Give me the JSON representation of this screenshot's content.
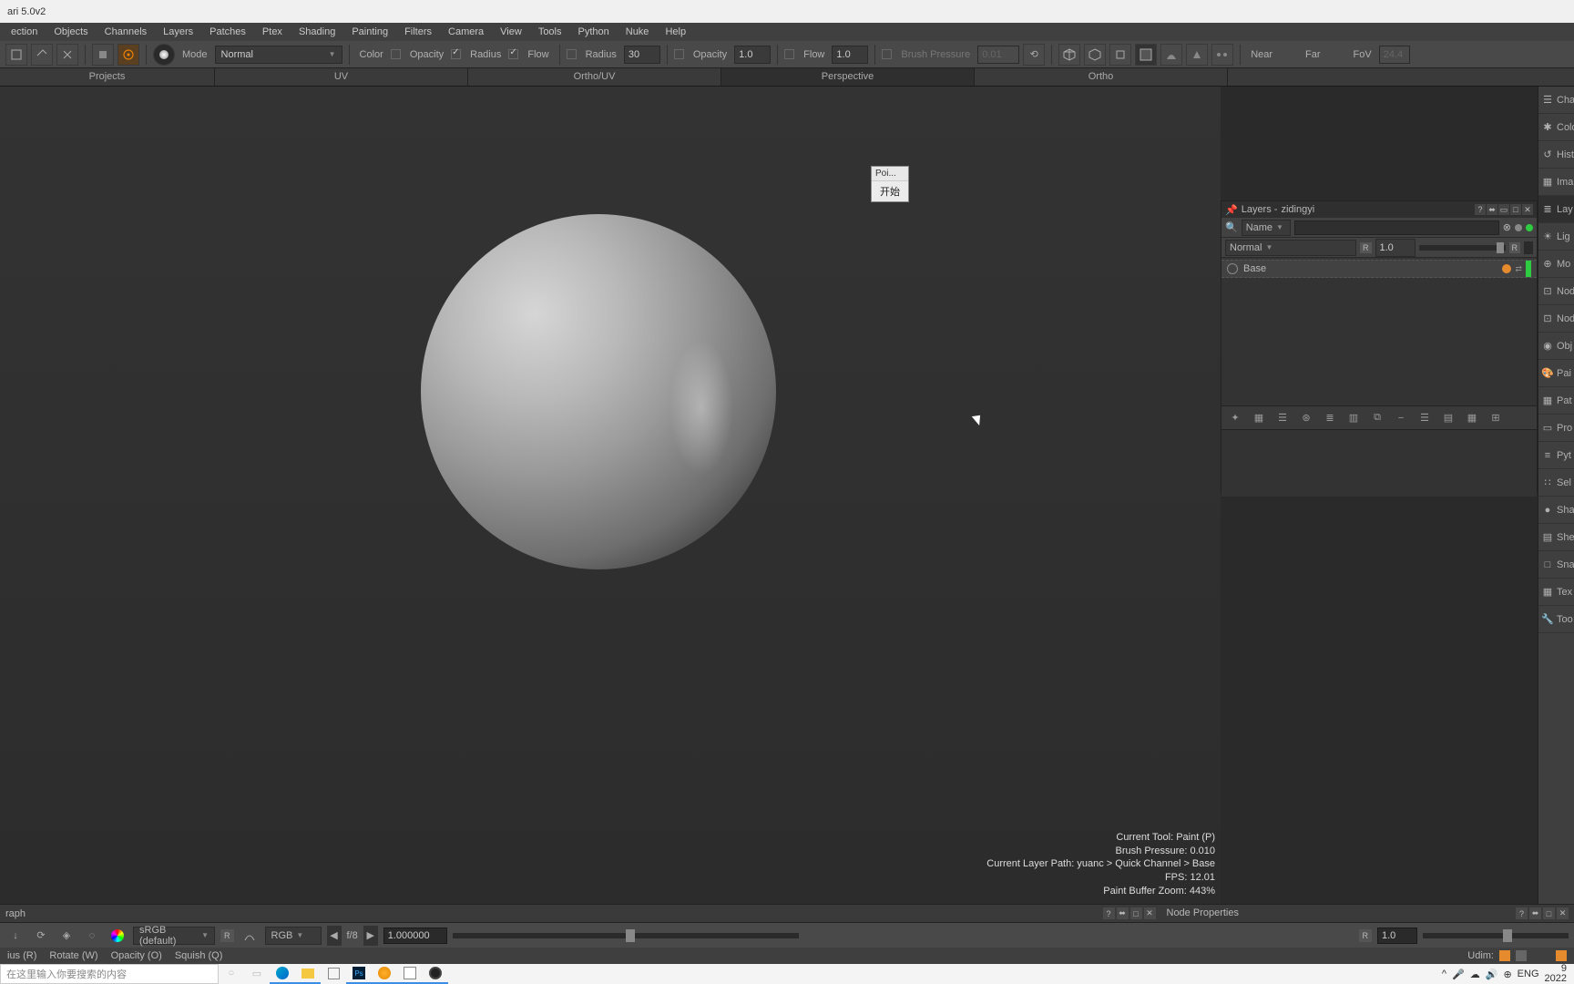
{
  "app": {
    "title_fragment": "ari 5.0v2"
  },
  "menu": [
    "ection",
    "Objects",
    "Channels",
    "Layers",
    "Patches",
    "Ptex",
    "Shading",
    "Painting",
    "Filters",
    "Camera",
    "View",
    "Tools",
    "Python",
    "Nuke",
    "Help"
  ],
  "toolbar": {
    "mode_label": "Mode",
    "mode_value": "Normal",
    "color_label": "Color",
    "opacity_label": "Opacity",
    "opacity2_label": "Opacity",
    "radius_label": "Radius",
    "flow_label": "Flow",
    "flow2_label": "Flow",
    "radius2_label": "Radius",
    "radius_value": "30",
    "opacity_value": "1.0",
    "flow_value": "1.0",
    "brush_pressure_label": "Brush Pressure",
    "brush_pressure_value": "0.01",
    "near_label": "Near",
    "far_label": "Far",
    "fov_label": "FoV",
    "fov_value": "24.4"
  },
  "tabs": {
    "projects": "Projects",
    "uv": "UV",
    "orthouv": "Ortho/UV",
    "perspective": "Perspective",
    "ortho": "Ortho"
  },
  "floater": {
    "head": "Poi...",
    "body": "开始"
  },
  "layers_panel": {
    "title_prefix": "Layers - ",
    "title_name": "zidingyi",
    "filter_label": "Name",
    "blend_mode": "Normal",
    "r_label": "R",
    "r_value": "1.0",
    "r_label2": "R",
    "layer1": "Base"
  },
  "right_tabs": [
    "Cha",
    "Cold",
    "Hist",
    "Ima",
    "Lay",
    "Lig",
    "Mo",
    "Nod",
    "Nod",
    "Obj",
    "Pai",
    "Pat",
    "Pro",
    "Pyt",
    "Sel",
    "Sha",
    "She",
    "Sna",
    "Tex",
    "Too"
  ],
  "hud": {
    "l1": "Current Tool: Paint (P)",
    "l2": "Brush Pressure: 0.010",
    "l3": "Current Layer Path: yuanc > Quick Channel > Base",
    "l4": "FPS: 12.01",
    "l5": "Paint Buffer Zoom: 443%"
  },
  "bottom_strip": {
    "left": "raph",
    "node_props": "Node Properties"
  },
  "color_bar": {
    "colorspace": "sRGB (default)",
    "r_label": "R",
    "channel": "RGB",
    "fstop": "f/8",
    "exposure": "1.000000",
    "r2_label": "R",
    "r2_value": "1.0"
  },
  "hint_bar": {
    "h1": "ius (R)",
    "h2": "Rotate (W)",
    "h3": "Opacity (O)",
    "h4": "Squish (Q)",
    "udim_label": "Udim:"
  },
  "taskbar": {
    "search_placeholder": "在这里输入你要搜索的内容",
    "lang": "ENG",
    "date": "2022",
    "temp": "9"
  }
}
